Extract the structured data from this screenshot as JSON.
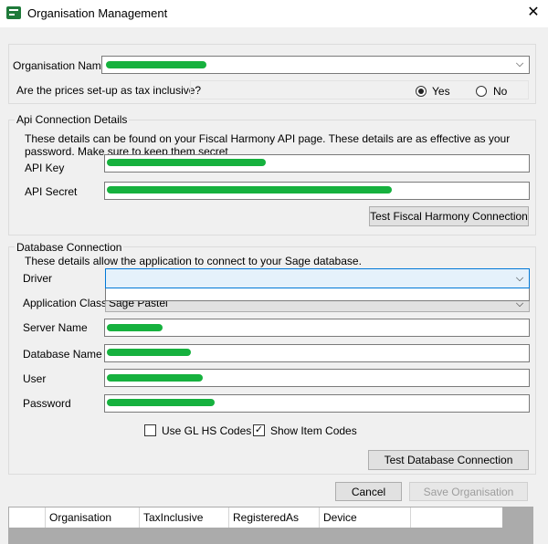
{
  "window": {
    "title": "Organisation Management",
    "close_label": "✕"
  },
  "organisation": {
    "label": "Organisation Name"
  },
  "tax": {
    "question": "Are the prices set-up as tax inclusive?",
    "yes_label": "Yes",
    "no_label": "No",
    "selected": "Yes"
  },
  "api": {
    "group_label": "Api Connection Details",
    "description": "These details can be found on your Fiscal Harmony API page. These details are as effective as your password. Make sure to keep them secret",
    "key_label": "API Key",
    "secret_label": "API Secret",
    "test_button": "Test Fiscal Harmony Connection"
  },
  "database": {
    "group_label": "Database Connection",
    "description": "These details allow the application to connect to your Sage database.",
    "driver_label": "Driver",
    "driver_value": "",
    "app_class_label": "Application Class",
    "app_class_value": "Sage Pastel",
    "server_label": "Server Name",
    "dbname_label": "Database Name",
    "user_label": "User",
    "password_label": "Password",
    "use_gl_label": "Use GL HS Codes",
    "use_gl_checked": false,
    "show_item_label": "Show Item Codes",
    "show_item_checked": true,
    "test_button": "Test Database Connection"
  },
  "actions": {
    "cancel": "Cancel",
    "save": "Save Organisation"
  },
  "grid": {
    "columns": [
      "Organisation",
      "TaxInclusive",
      "RegisteredAs",
      "Device"
    ]
  },
  "colors": {
    "redaction": "#16b13e",
    "focus_border": "#0078d7",
    "focus_fill": "#e5f1fb"
  }
}
